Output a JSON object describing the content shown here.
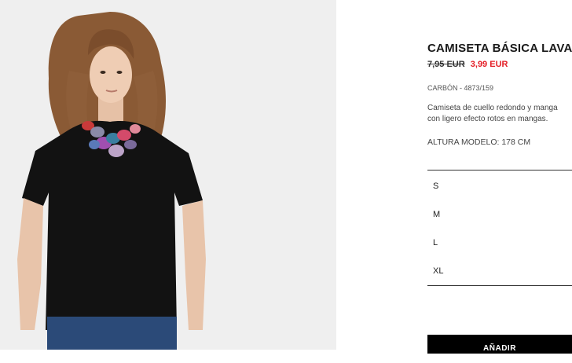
{
  "product": {
    "title": "CAMISETA BÁSICA LAVADA",
    "old_price": "7,95 EUR",
    "new_price": "3,99 EUR",
    "reference": "CARBÓN - 4873/159",
    "description_lines": [
      "Camiseta de cuello redondo y manga",
      "con ligero efecto rotos en mangas."
    ],
    "model_height": "ALTURA MODELO: 178 CM"
  },
  "sizes": [
    "S",
    "M",
    "L",
    "XL"
  ],
  "add_button_label": "AÑADIR",
  "colors": {
    "price_sale": "#e41e26",
    "button_bg": "#000000",
    "photo_bg": "#efefef"
  }
}
